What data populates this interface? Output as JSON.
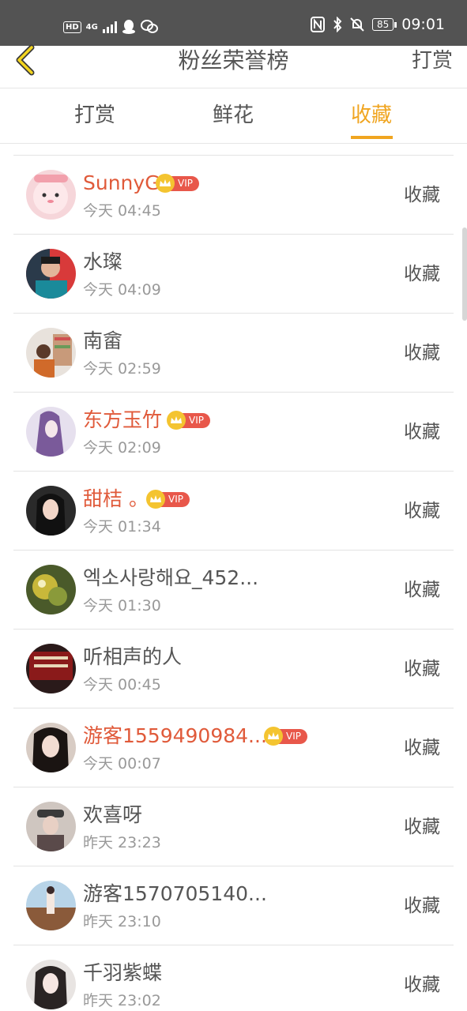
{
  "status_bar": {
    "time": "09:01",
    "battery": "85",
    "hd": "HD",
    "network": "4G"
  },
  "header": {
    "title": "粉丝荣誉榜",
    "right_label": "打赏"
  },
  "tabs": [
    {
      "label": "打赏",
      "active": false
    },
    {
      "label": "鲜花",
      "active": false
    },
    {
      "label": "收藏",
      "active": true
    }
  ],
  "vip_label": "VIP",
  "rows": [
    {
      "name": "SunnyG",
      "time": "今天 04:45",
      "action": "收藏",
      "vip": true
    },
    {
      "name": "水璨",
      "time": "今天 04:09",
      "action": "收藏",
      "vip": false
    },
    {
      "name": "南畲",
      "time": "今天 02:59",
      "action": "收藏",
      "vip": false
    },
    {
      "name": "东方玉竹",
      "time": "今天 02:09",
      "action": "收藏",
      "vip": true
    },
    {
      "name": "甜桔 。",
      "time": "今天 01:34",
      "action": "收藏",
      "vip": true
    },
    {
      "name": "엑소사랑해요_452...",
      "time": "今天 01:30",
      "action": "收藏",
      "vip": false
    },
    {
      "name": "听相声的人",
      "time": "今天 00:45",
      "action": "收藏",
      "vip": false
    },
    {
      "name": "游客1559490984...",
      "time": "今天 00:07",
      "action": "收藏",
      "vip": true
    },
    {
      "name": "欢喜呀",
      "time": "昨天 23:23",
      "action": "收藏",
      "vip": false
    },
    {
      "name": "游客1570705140...",
      "time": "昨天 23:10",
      "action": "收藏",
      "vip": false
    },
    {
      "name": "千羽紫蝶",
      "time": "昨天 23:02",
      "action": "收藏",
      "vip": false
    }
  ],
  "colors": {
    "accent": "#f0a520",
    "vip_name": "#e05a3a",
    "vip_tag": "#e8574a",
    "status_bar": "#535353"
  }
}
